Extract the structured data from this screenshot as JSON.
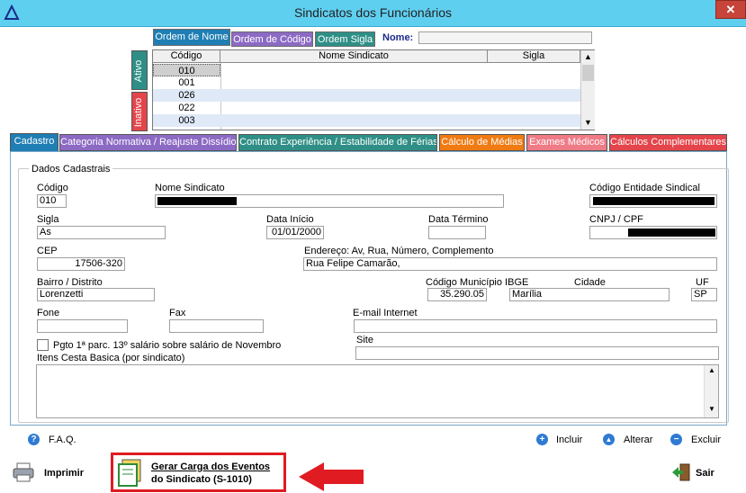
{
  "window": {
    "title": "Sindicatos dos Funcionários",
    "close_label": "✕"
  },
  "order_tabs": [
    {
      "label": "Ordem de Nome",
      "color": "#1f7fb4"
    },
    {
      "label": "Ordem de Código",
      "color": "#8c6ac4"
    },
    {
      "label": "Ordem Sigla",
      "color": "#2f8f86"
    }
  ],
  "name_search": {
    "label": "Nome:",
    "value": ""
  },
  "grid": {
    "columns": [
      "Código",
      "Nome Sindicato",
      "Sigla"
    ],
    "rows": [
      {
        "code": "010",
        "name": "",
        "sigla": ""
      },
      {
        "code": "001",
        "name": "",
        "sigla": ""
      },
      {
        "code": "026",
        "name": "",
        "sigla": ""
      },
      {
        "code": "022",
        "name": "",
        "sigla": ""
      },
      {
        "code": "003",
        "name": "",
        "sigla": ""
      }
    ]
  },
  "side_tabs": {
    "ativo": "Ativo",
    "inativo": "Inativo"
  },
  "main_tabs": [
    {
      "label": "Cadastro",
      "color": "#1f7fb4"
    },
    {
      "label": "Categoria Normativa / Reajuste Dissídio",
      "color": "#8c6ac4"
    },
    {
      "label": "Contrato Experiência / Estabilidade de Férias",
      "color": "#2f8f86"
    },
    {
      "label": "Cálculo de Médias",
      "color": "#f07b12"
    },
    {
      "label": "Exames Médicos",
      "color": "#ef7b87"
    },
    {
      "label": "Cálculos Complementares",
      "color": "#e4454b"
    }
  ],
  "form": {
    "group_title": "Dados Cadastrais",
    "codigo": {
      "label": "Código",
      "value": "010"
    },
    "nome_sindicato": {
      "label": "Nome Sindicato",
      "value": ""
    },
    "codigo_entidade": {
      "label": "Código Entidade Sindical",
      "value": ""
    },
    "sigla": {
      "label": "Sigla",
      "value": "As"
    },
    "data_inicio": {
      "label": "Data Início",
      "value": "01/01/2000"
    },
    "data_termino": {
      "label": "Data Término",
      "value": ""
    },
    "cnpj": {
      "label": "CNPJ / CPF",
      "value": ""
    },
    "cep": {
      "label": "CEP",
      "value": "17506-320"
    },
    "endereco": {
      "label": "Endereço: Av, Rua, Número, Complemento",
      "value": "Rua Felipe Camarão,"
    },
    "bairro": {
      "label": "Bairro / Distrito",
      "value": "Lorenzetti"
    },
    "codigo_municipio": {
      "label": "Código Município IBGE",
      "value": "35.290.05"
    },
    "cidade": {
      "label": "Cidade",
      "value": "Marília"
    },
    "uf": {
      "label": "UF",
      "value": "SP"
    },
    "fone": {
      "label": "Fone",
      "value": ""
    },
    "fax": {
      "label": "Fax",
      "value": ""
    },
    "email": {
      "label": "E-mail Internet",
      "value": ""
    },
    "pgto_checkbox": {
      "label": "Pgto 1ª parc. 13º salário sobre salário de Novembro",
      "checked": false
    },
    "site": {
      "label": "Site",
      "value": ""
    },
    "itens_cesta": {
      "label": "Itens Cesta Basica (por sindicato)",
      "value": ""
    }
  },
  "actions": {
    "faq": "F.A.Q.",
    "incluir": "Incluir",
    "alterar": "Alterar",
    "excluir": "Excluir",
    "imprimir": "Imprimir",
    "gerar_line1": "Gerar Carga dos Eventos",
    "gerar_line2": "do Sindicato (S-1010)",
    "sair": "Sair"
  }
}
